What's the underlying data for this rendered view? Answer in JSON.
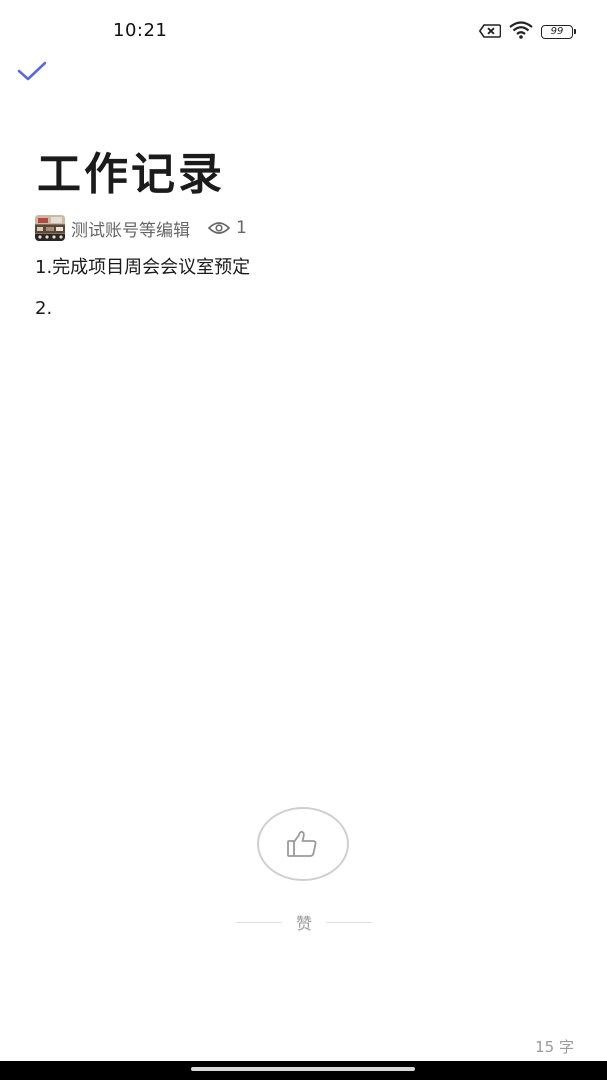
{
  "status_bar": {
    "time": "10:21",
    "battery_level": "99",
    "icons": [
      "sim-card-x-icon",
      "wifi-icon",
      "battery-icon"
    ]
  },
  "toolbar": {
    "done_icon": "check-icon",
    "accent_color": "#5b6cd6"
  },
  "document": {
    "title": "工作记录",
    "editor_text": "测试账号等编辑",
    "view_count": "1",
    "lines": [
      "1.完成项目周会会议室预定",
      "2."
    ]
  },
  "like": {
    "label": "赞",
    "icon": "thumbs-up-icon"
  },
  "footer": {
    "word_count": "15 字"
  }
}
